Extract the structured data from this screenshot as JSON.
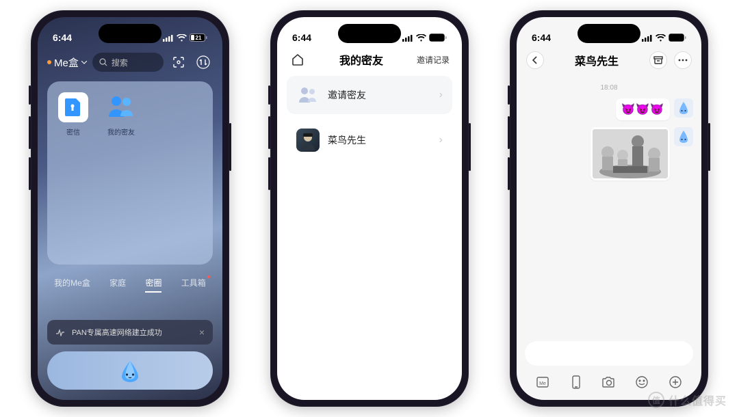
{
  "status": {
    "time": "6:44",
    "battery": "21"
  },
  "phone1": {
    "brand": "Me盒",
    "search_placeholder": "搜索",
    "apps": [
      {
        "label": "密信"
      },
      {
        "label": "我的密友"
      }
    ],
    "tabs": [
      {
        "label": "我的Me盒"
      },
      {
        "label": "家庭"
      },
      {
        "label": "密圈",
        "active": true
      },
      {
        "label": "工具箱",
        "badge": true
      }
    ],
    "toast": "PAN专属高速网络建立成功"
  },
  "phone2": {
    "title": "我的密友",
    "right_link": "邀请记录",
    "rows": [
      {
        "label": "邀请密友",
        "kind": "invite"
      },
      {
        "label": "菜鸟先生",
        "kind": "friend"
      }
    ]
  },
  "phone3": {
    "title": "菜鸟先生",
    "timestamp": "18:08",
    "messages": [
      {
        "type": "emoji",
        "content": "😈😈😈"
      },
      {
        "type": "image"
      }
    ],
    "bottom_icons": [
      "me",
      "phone",
      "camera",
      "smile",
      "plus"
    ]
  },
  "watermark": "什么值得买"
}
